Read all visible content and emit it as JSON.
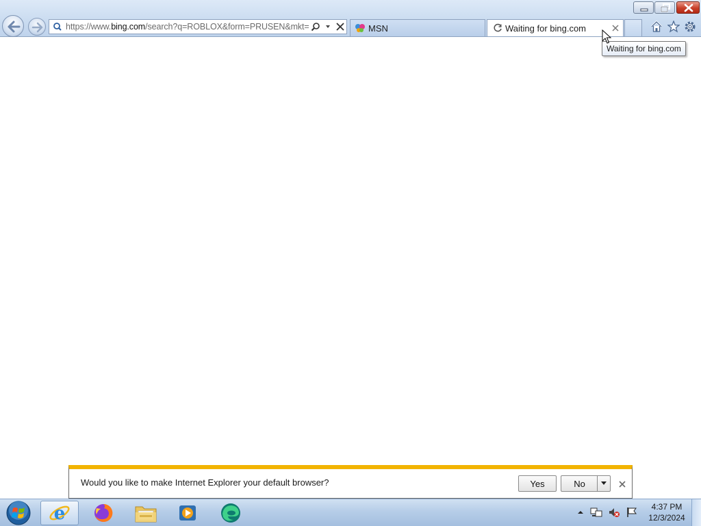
{
  "browser": {
    "address": {
      "url_prefix": "https://www.",
      "url_domain": "bing.com",
      "url_suffix": "/search?q=ROBLOX&form=PRUSEN&mkt=e"
    },
    "tabs": [
      {
        "label": "MSN",
        "icon": "msn-butterfly-icon",
        "active": false
      },
      {
        "label": "Waiting for bing.com",
        "icon": "loading-spinner-icon",
        "active": true
      }
    ],
    "tooltip": "Waiting for bing.com",
    "toolbar_icons": [
      "home-icon",
      "favorites-star-icon",
      "gear-icon"
    ]
  },
  "notification": {
    "message": "Would you like to make Internet Explorer your default browser?",
    "yes_label": "Yes",
    "no_label": "No",
    "accent": "#f2b400"
  },
  "taskbar": {
    "pinned": [
      "internet-explorer-icon",
      "firefox-icon",
      "file-explorer-icon",
      "media-player-icon",
      "edge-icon"
    ],
    "active": "internet-explorer-icon",
    "clock": {
      "time": "4:37 PM",
      "date": "12/3/2024"
    },
    "tray_icons": [
      "show-hidden-icons-icon",
      "network-icon",
      "volume-muted-icon",
      "action-center-flag-icon"
    ]
  }
}
